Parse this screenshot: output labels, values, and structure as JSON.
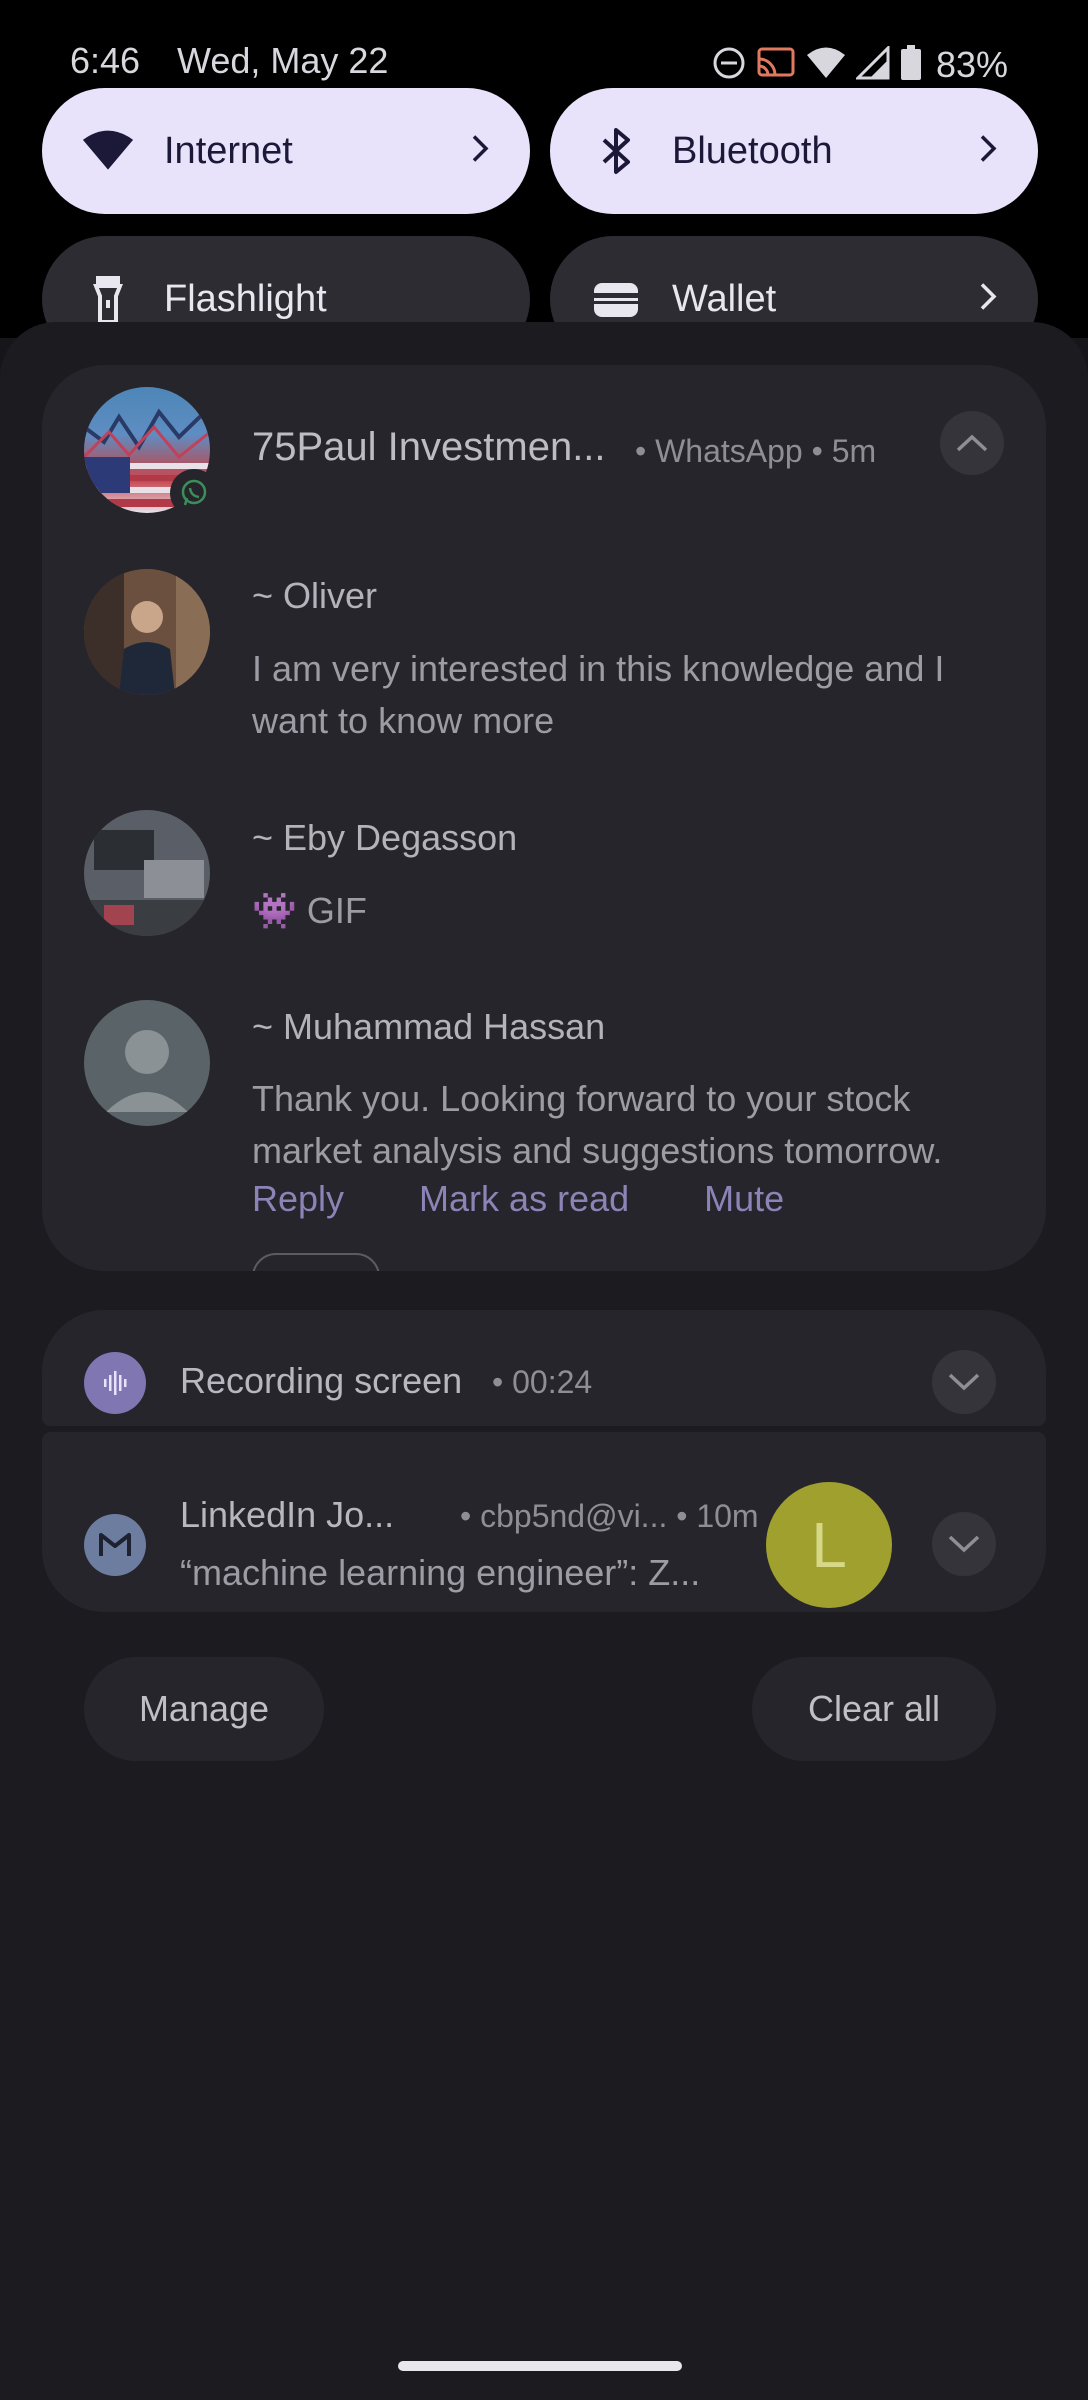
{
  "status_bar": {
    "time": "6:46",
    "date": "Wed, May 22",
    "battery": "83%",
    "icons": [
      "do-not-disturb-icon",
      "cast-icon",
      "wifi-icon",
      "cellular-signal-icon",
      "battery-icon"
    ]
  },
  "quick_settings": {
    "tiles": [
      {
        "label": "Internet",
        "icon": "wifi-icon",
        "active": true
      },
      {
        "label": "Bluetooth",
        "icon": "bluetooth-icon",
        "active": true
      },
      {
        "label": "Flashlight",
        "icon": "flashlight-icon",
        "active": false
      },
      {
        "label": "Wallet",
        "icon": "wallet-icon",
        "active": false
      }
    ]
  },
  "whatsapp": {
    "group": "75Paul Investmen...",
    "meta": "• WhatsApp • 5m",
    "messages": [
      {
        "sender": "~ Oliver",
        "text": "I am very interested in this knowledge and I want to know more"
      },
      {
        "sender": "~ Eby Degasson",
        "text": "👾 GIF"
      },
      {
        "sender": "~ Muhammad Hassan",
        "text": "Thank you. Looking forward to your stock market analysis and suggestions tomorrow."
      }
    ],
    "actions": {
      "reply": "Reply",
      "mark_read": "Mark as read",
      "mute": "Mute"
    }
  },
  "recording": {
    "title": "Recording screen",
    "time": "• 00:24"
  },
  "linkedin": {
    "title": "LinkedIn Jo...",
    "meta": "• cbp5nd@vi... • 10m",
    "text": "“machine learning engineer”: Z...",
    "avatar_letter": "L"
  },
  "footer": {
    "manage": "Manage",
    "clear_all": "Clear all"
  },
  "colors": {
    "accent_tile": "#e8e2fb",
    "panel": "#1b1b20",
    "card": "#26252b",
    "action_text": "#8c83b7"
  }
}
